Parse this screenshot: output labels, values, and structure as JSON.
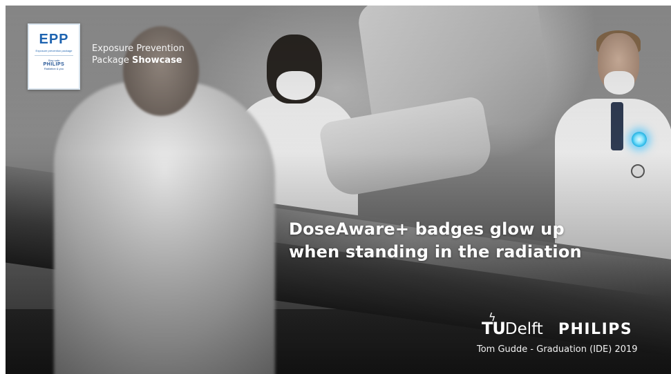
{
  "logo": {
    "mark": "EPP",
    "subtitle": "Exposure prevention package",
    "stay_safe": "Stay safe",
    "brand": "PHILIPS",
    "tagline": "Radiation & you"
  },
  "caption": {
    "line1": "Exposure Prevention",
    "line2_regular": "Package",
    "line2_bold": "Showcase"
  },
  "headline": {
    "line1": "DoseAware+ badges glow up",
    "line2": "when standing in the radiation"
  },
  "brands": {
    "tud_flame": "ϟ",
    "tud_tu": "TU",
    "tud_delft": "Delft",
    "philips": "PHILIPS"
  },
  "credit": "Tom Gudde - Graduation (IDE) 2019",
  "colors": {
    "epp_blue": "#1d63b0",
    "badge_glow": "#7fe3ff",
    "text": "#ffffff"
  },
  "icons": [
    "epp-logo",
    "tudelft-flame-icon",
    "glowing-badge-icon"
  ]
}
